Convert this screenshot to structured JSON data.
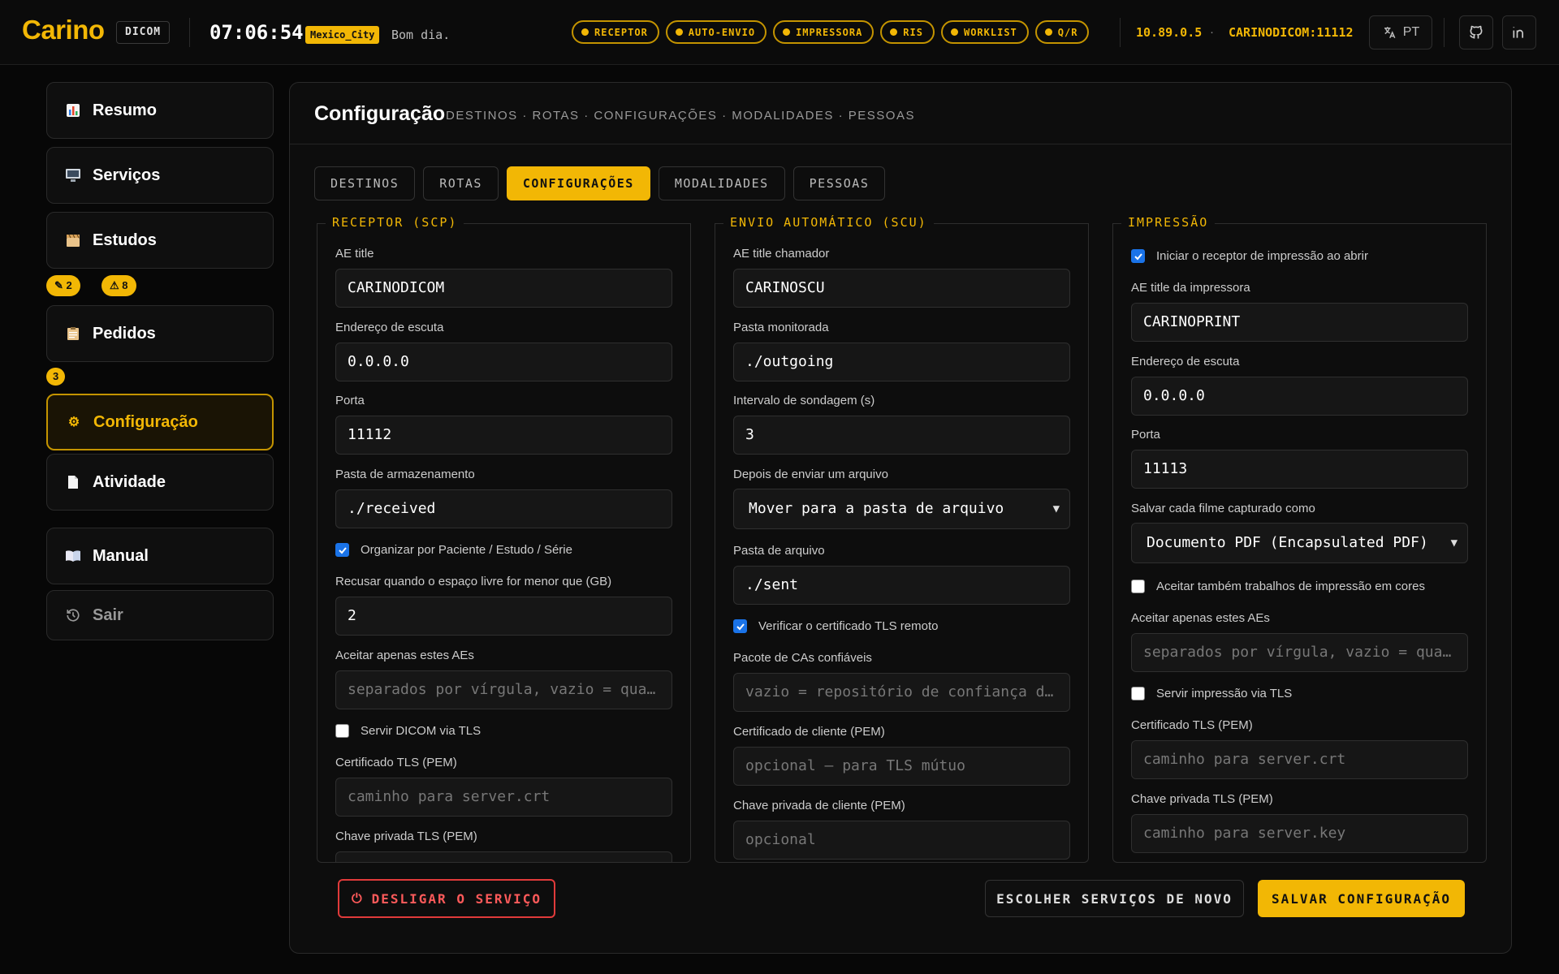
{
  "header": {
    "logo": "Carino",
    "brand_badge": "DICOM",
    "clock": "07:06:54",
    "timezone": "Mexico_City",
    "greeting": "Bom dia.",
    "services": [
      "RECEPTOR",
      "AUTO-ENVIO",
      "IMPRESSORA",
      "RIS",
      "WORKLIST",
      "Q/R"
    ],
    "ip": "10.89.0.5",
    "separator": "·",
    "ae_port": "CARINODICOM:11112",
    "language": "PT",
    "icons": {
      "language": "translate-icon",
      "github": "github-icon",
      "linkedin": "linkedin-icon"
    }
  },
  "sidebar": {
    "items": [
      {
        "label": "Resumo",
        "icon": "chart-icon"
      },
      {
        "label": "Serviços",
        "icon": "monitor-icon"
      },
      {
        "label": "Estudos",
        "icon": "clapperboard-icon"
      },
      {
        "label": "Pedidos",
        "icon": "clipboard-icon"
      },
      {
        "label": "Configuração",
        "icon": "gear-icon"
      },
      {
        "label": "Atividade",
        "icon": "document-icon"
      },
      {
        "label": "Manual",
        "icon": "book-icon"
      },
      {
        "label": "Sair",
        "icon": "power-icon"
      }
    ],
    "studies_badges": [
      {
        "icon": "pencil-icon",
        "count": "2"
      },
      {
        "icon": "warning-icon",
        "count": "8"
      }
    ],
    "orders_badge": "3"
  },
  "main": {
    "title": "Configuração",
    "subtitle": "DESTINOS · ROTAS · CONFIGURAÇÕES · MODALIDADES · PESSOAS",
    "tabs": [
      "DESTINOS",
      "ROTAS",
      "CONFIGURAÇÕES",
      "MODALIDADES",
      "PESSOAS"
    ],
    "active_tab": "CONFIGURAÇÕES",
    "receptor": {
      "legend": "RECEPTOR (SCP)",
      "ae_title_label": "AE title",
      "ae_title": "CARINODICOM",
      "listen_label": "Endereço de escuta",
      "listen": "0.0.0.0",
      "port_label": "Porta",
      "port": "11112",
      "storage_label": "Pasta de armazenamento",
      "storage": "./received",
      "organize_label": "Organizar por Paciente / Estudo / Série",
      "organize": true,
      "refuse_label": "Recusar quando o espaço livre for menor que (GB)",
      "refuse": "2",
      "accept_label": "Aceitar apenas estes AEs",
      "accept_placeholder": "separados por vírgula, vazio = qua…",
      "tls_label": "Servir DICOM via TLS",
      "tls": false,
      "cert_label": "Certificado TLS (PEM)",
      "cert_placeholder": "caminho para server.crt",
      "key_label": "Chave privada TLS (PEM)"
    },
    "envio": {
      "legend": "ENVIO AUTOMÁTICO (SCU)",
      "caller_label": "AE title chamador",
      "caller": "CARINOSCU",
      "watch_label": "Pasta monitorada",
      "watch": "./outgoing",
      "poll_label": "Intervalo de sondagem (s)",
      "poll": "3",
      "after_label": "Depois de enviar um arquivo",
      "after": "Mover para a pasta de arquivo",
      "archive_label": "Pasta de arquivo",
      "archive": "./sent",
      "verify_label": "Verificar o certificado TLS remoto",
      "verify": true,
      "ca_label": "Pacote de CAs confiáveis",
      "ca_placeholder": "vazio = repositório de confiança d…",
      "client_cert_label": "Certificado de cliente (PEM)",
      "client_cert_placeholder": "opcional — para TLS mútuo",
      "client_key_label": "Chave privada de cliente (PEM)",
      "client_key_placeholder": "opcional"
    },
    "impressao": {
      "legend": "IMPRESSÃO",
      "autostart_label": "Iniciar o receptor de impressão ao abrir",
      "autostart": true,
      "ae_label": "AE title da impressora",
      "ae": "CARINOPRINT",
      "listen_label": "Endereço de escuta",
      "listen": "0.0.0.0",
      "port_label": "Porta",
      "port": "11113",
      "save_label": "Salvar cada filme capturado como",
      "save": "Documento PDF (Encapsulated PDF)",
      "color_label": "Aceitar também trabalhos de impressão em cores",
      "color": false,
      "accept_label": "Aceitar apenas estes AEs",
      "accept_placeholder": "separados por vírgula, vazio = qua…",
      "tls_label": "Servir impressão via TLS",
      "tls": false,
      "cert_label": "Certificado TLS (PEM)",
      "cert_placeholder": "caminho para server.crt",
      "key_label": "Chave privada TLS (PEM)",
      "key_placeholder": "caminho para server.key"
    },
    "footer": {
      "shutdown": "DESLIGAR O SERVIÇO",
      "choose": "ESCOLHER SERVIÇOS DE NOVO",
      "save": "SALVAR CONFIGURAÇÃO"
    }
  },
  "colors": {
    "accent": "#f2b705",
    "danger": "#e03a3a",
    "background": "#070707"
  }
}
